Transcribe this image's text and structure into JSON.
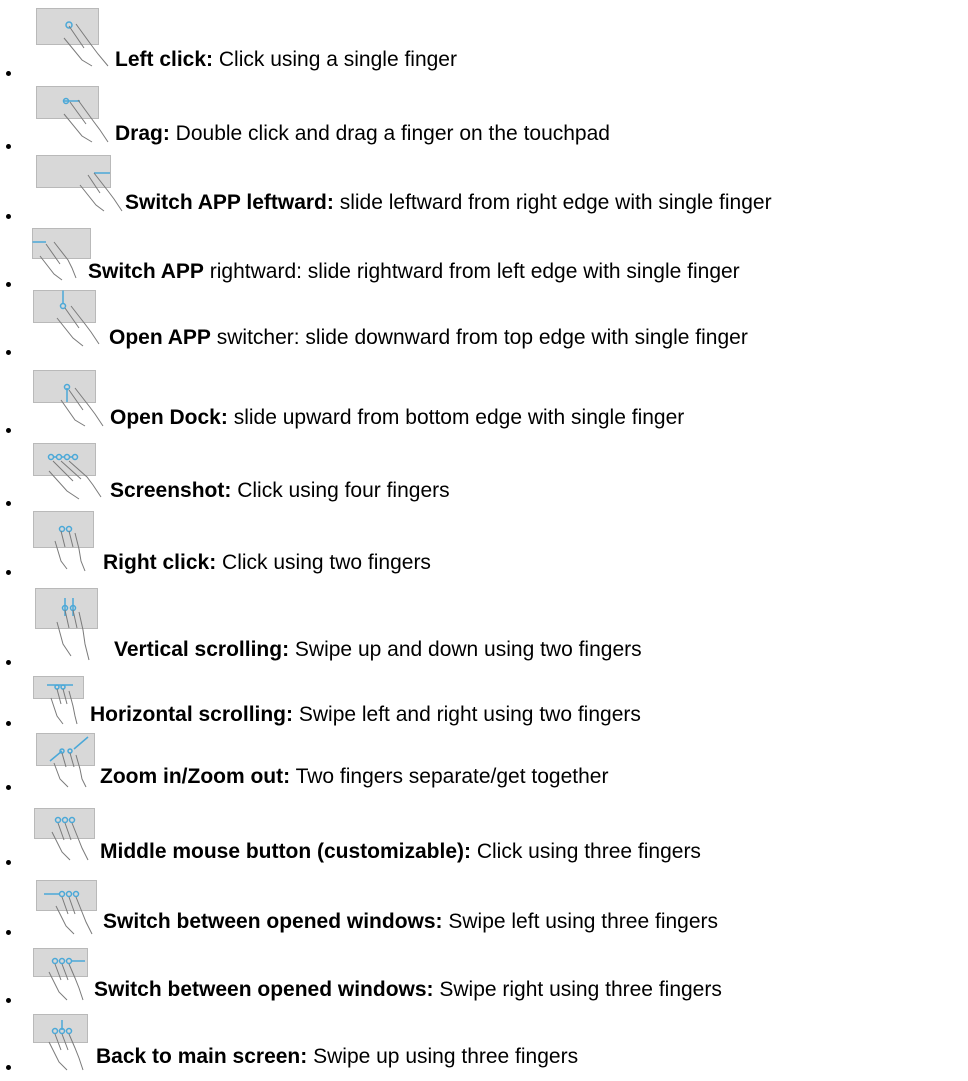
{
  "items": [
    {
      "bold": "Left click:",
      "rest": " Click using a single finger",
      "icon": "single-finger-tap-icon"
    },
    {
      "bold": "Drag:",
      "rest": " Double click and drag a finger on the touchpad",
      "icon": "single-finger-drag-icon"
    },
    {
      "bold": "Switch APP leftward:",
      "rest": " slide leftward from right edge with single finger",
      "icon": "swipe-from-right-edge-icon"
    },
    {
      "bold": "Switch APP",
      "rest": " rightward: slide rightward from left edge with single finger",
      "icon": "swipe-from-left-edge-icon"
    },
    {
      "bold": "Open APP",
      "rest": " switcher: slide downward from top edge with single finger",
      "icon": "swipe-from-top-edge-icon"
    },
    {
      "bold": "Open Dock:",
      "rest": " slide upward from bottom edge with single finger",
      "icon": "swipe-from-bottom-edge-icon"
    },
    {
      "bold": "Screenshot:",
      "rest": " Click using four fingers",
      "icon": "four-finger-tap-icon"
    },
    {
      "bold": "Right click:",
      "rest": " Click using two fingers",
      "icon": "two-finger-tap-icon"
    },
    {
      "bold": "Vertical scrolling:",
      "rest": " Swipe up and down using two fingers",
      "icon": "two-finger-vertical-scroll-icon"
    },
    {
      "bold": "Horizontal scrolling:",
      "rest": " Swipe left and right using two fingers",
      "icon": "two-finger-horizontal-scroll-icon"
    },
    {
      "bold": "Zoom in/Zoom out:",
      "rest": " Two fingers separate/get together",
      "icon": "pinch-zoom-icon"
    },
    {
      "bold": "Middle mouse button (customizable):",
      "rest": "  Click using three fingers",
      "icon": "three-finger-tap-icon"
    },
    {
      "bold": "Switch between opened windows:",
      "rest": " Swipe left using three fingers",
      "icon": "three-finger-swipe-left-icon"
    },
    {
      "bold": "Switch between opened windows:",
      "rest": " Swipe right using three fingers",
      "icon": "three-finger-swipe-right-icon"
    },
    {
      "bold": "Back to main screen:",
      "rest": " Swipe up using three fingers",
      "icon": "three-finger-swipe-up-icon"
    }
  ],
  "colors": {
    "pad_fill": "#d8d8d8",
    "pad_border": "#b9b9b9",
    "gesture_accent": "#4aa8d8",
    "hand_stroke": "#7a7a7a"
  }
}
